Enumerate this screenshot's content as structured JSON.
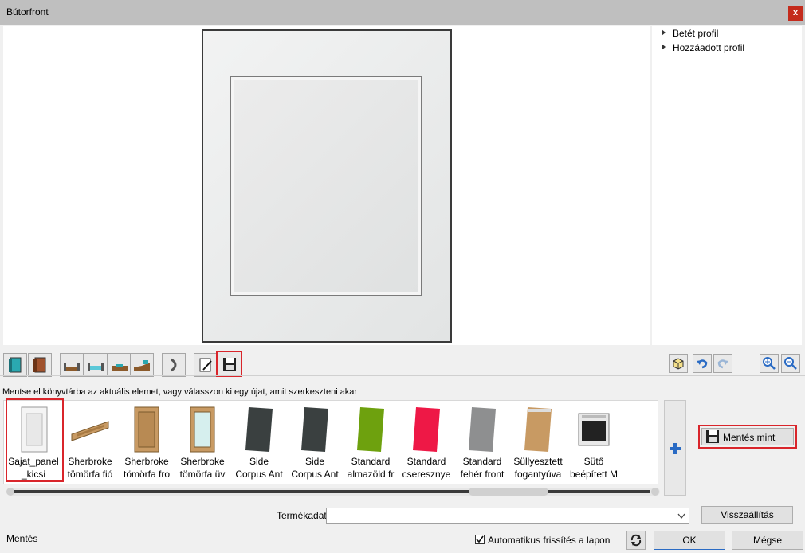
{
  "window": {
    "title": "Bútorfront",
    "close_label": "x"
  },
  "tree": {
    "items": [
      {
        "label": "Betét profil"
      },
      {
        "label": "Hozzáadott profil"
      }
    ]
  },
  "hint": "Mentse el könyvtárba az aktuális elemet, vagy válasszon ki egy újat, amit szerkeszteni akar",
  "library": {
    "items": [
      {
        "line1": "Sajat_panel",
        "line2": "_kicsi",
        "icon": "white-panel-door",
        "selected": true
      },
      {
        "line1": "Sherbroke",
        "line2": "tömörfa fió",
        "icon": "oak-drawer-front"
      },
      {
        "line1": "Sherbroke",
        "line2": "tömörfa fro",
        "icon": "oak-door"
      },
      {
        "line1": "Sherbroke",
        "line2": "tömörfa üv",
        "icon": "oak-glass-door"
      },
      {
        "line1": "Side",
        "line2": "Corpus Ant",
        "icon": "anthracite-panel"
      },
      {
        "line1": "Side",
        "line2": "Corpus Ant",
        "icon": "anthracite-panel"
      },
      {
        "line1": "Standard",
        "line2": "almazöld fr",
        "icon": "green-panel"
      },
      {
        "line1": "Standard",
        "line2": "cseresznye",
        "icon": "red-panel"
      },
      {
        "line1": "Standard",
        "line2": "fehér front",
        "icon": "grey-panel"
      },
      {
        "line1": "Süllyesztett",
        "line2": "fogantyúva",
        "icon": "oak-handle-panel"
      },
      {
        "line1": "Sütő",
        "line2": "beépített M",
        "icon": "oven"
      }
    ]
  },
  "buttons": {
    "save_as": "Mentés mint",
    "reset": "Visszaállítás",
    "ok": "OK",
    "cancel": "Mégse"
  },
  "product": {
    "label": "Termékadat",
    "value": ""
  },
  "auto_refresh": {
    "label": "Automatikus frissítés a lapon",
    "checked": true
  },
  "status": "Mentés",
  "colors": {
    "selection_red": "#d9252b",
    "selected_fill": "#bfe4ea",
    "accent_blue": "#2a6bc4"
  }
}
